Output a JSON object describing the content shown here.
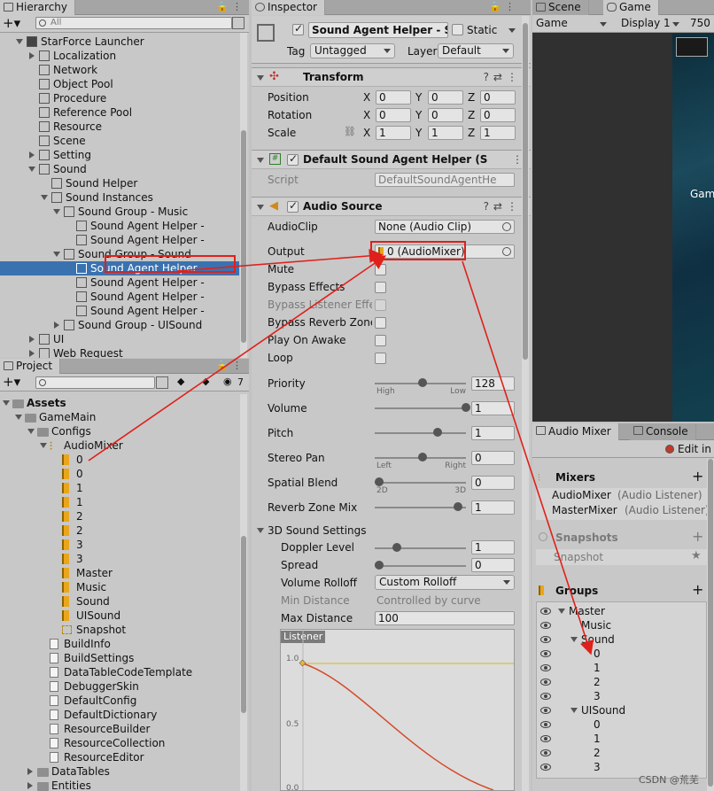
{
  "hierarchy": {
    "tab": "Hierarchy",
    "search_placeholder": "All",
    "items": [
      {
        "label": "StarForce Launcher",
        "indent": 0,
        "type": "root",
        "expanded": true
      },
      {
        "label": "Localization",
        "indent": 1,
        "type": "collapsed"
      },
      {
        "label": "Network",
        "indent": 1,
        "type": "leaf"
      },
      {
        "label": "Object Pool",
        "indent": 1,
        "type": "leaf"
      },
      {
        "label": "Procedure",
        "indent": 1,
        "type": "leaf"
      },
      {
        "label": "Reference Pool",
        "indent": 1,
        "type": "leaf"
      },
      {
        "label": "Resource",
        "indent": 1,
        "type": "leaf"
      },
      {
        "label": "Scene",
        "indent": 1,
        "type": "leaf"
      },
      {
        "label": "Setting",
        "indent": 1,
        "type": "collapsed"
      },
      {
        "label": "Sound",
        "indent": 1,
        "type": "expanded"
      },
      {
        "label": "Sound Helper",
        "indent": 2,
        "type": "leaf"
      },
      {
        "label": "Sound Instances",
        "indent": 2,
        "type": "expanded"
      },
      {
        "label": "Sound Group - Music",
        "indent": 3,
        "type": "expanded"
      },
      {
        "label": "Sound Agent Helper -",
        "indent": 4,
        "type": "leaf"
      },
      {
        "label": "Sound Agent Helper -",
        "indent": 4,
        "type": "leaf"
      },
      {
        "label": "Sound Group - Sound",
        "indent": 3,
        "type": "expanded"
      },
      {
        "label": "Sound Agent Helper -",
        "indent": 4,
        "type": "leaf",
        "selected": true
      },
      {
        "label": "Sound Agent Helper -",
        "indent": 4,
        "type": "leaf"
      },
      {
        "label": "Sound Agent Helper -",
        "indent": 4,
        "type": "leaf"
      },
      {
        "label": "Sound Agent Helper -",
        "indent": 4,
        "type": "leaf"
      },
      {
        "label": "Sound Group - UISound",
        "indent": 3,
        "type": "collapsed"
      },
      {
        "label": "UI",
        "indent": 1,
        "type": "collapsed"
      },
      {
        "label": "Web Request",
        "indent": 1,
        "type": "collapsed"
      }
    ]
  },
  "project": {
    "tab": "Project",
    "badge": "7",
    "items": [
      {
        "label": "Assets",
        "indent": 0,
        "kind": "folder",
        "expanded": true,
        "bold": true
      },
      {
        "label": "GameMain",
        "indent": 1,
        "kind": "folder",
        "expanded": true
      },
      {
        "label": "Configs",
        "indent": 2,
        "kind": "folder",
        "expanded": true
      },
      {
        "label": "AudioMixer",
        "indent": 3,
        "kind": "mixer",
        "expanded": true
      },
      {
        "label": "0",
        "indent": 4,
        "kind": "group"
      },
      {
        "label": "0",
        "indent": 4,
        "kind": "group"
      },
      {
        "label": "1",
        "indent": 4,
        "kind": "group"
      },
      {
        "label": "1",
        "indent": 4,
        "kind": "group"
      },
      {
        "label": "2",
        "indent": 4,
        "kind": "group"
      },
      {
        "label": "2",
        "indent": 4,
        "kind": "group"
      },
      {
        "label": "3",
        "indent": 4,
        "kind": "group"
      },
      {
        "label": "3",
        "indent": 4,
        "kind": "group"
      },
      {
        "label": "Master",
        "indent": 4,
        "kind": "group"
      },
      {
        "label": "Music",
        "indent": 4,
        "kind": "group"
      },
      {
        "label": "Sound",
        "indent": 4,
        "kind": "group"
      },
      {
        "label": "UISound",
        "indent": 4,
        "kind": "group"
      },
      {
        "label": "Snapshot",
        "indent": 4,
        "kind": "snapshot"
      },
      {
        "label": "BuildInfo",
        "indent": 3,
        "kind": "file"
      },
      {
        "label": "BuildSettings",
        "indent": 3,
        "kind": "file"
      },
      {
        "label": "DataTableCodeTemplate",
        "indent": 3,
        "kind": "file"
      },
      {
        "label": "DebuggerSkin",
        "indent": 3,
        "kind": "file"
      },
      {
        "label": "DefaultConfig",
        "indent": 3,
        "kind": "file"
      },
      {
        "label": "DefaultDictionary",
        "indent": 3,
        "kind": "file"
      },
      {
        "label": "ResourceBuilder",
        "indent": 3,
        "kind": "file"
      },
      {
        "label": "ResourceCollection",
        "indent": 3,
        "kind": "file"
      },
      {
        "label": "ResourceEditor",
        "indent": 3,
        "kind": "file"
      },
      {
        "label": "DataTables",
        "indent": 2,
        "kind": "folder",
        "expanded": false
      },
      {
        "label": "Entities",
        "indent": 2,
        "kind": "folder",
        "expanded": false
      }
    ]
  },
  "inspector": {
    "tab": "Inspector",
    "object_name": "Sound Agent Helper - Sou",
    "static_label": "Static",
    "tag_label": "Tag",
    "tag_value": "Untagged",
    "layer_label": "Layer",
    "layer_value": "Default",
    "transform": {
      "title": "Transform",
      "rows": [
        {
          "label": "Position",
          "x": "0",
          "y": "0",
          "z": "0"
        },
        {
          "label": "Rotation",
          "x": "0",
          "y": "0",
          "z": "0"
        },
        {
          "label": "Scale",
          "x": "1",
          "y": "1",
          "z": "1"
        }
      ]
    },
    "script_component": {
      "title": "Default Sound Agent Helper (S",
      "script_label": "Script",
      "script_value": "DefaultSoundAgentHe"
    },
    "audio_source": {
      "title": "Audio Source",
      "audioclip_label": "AudioClip",
      "audioclip_value": "None (Audio Clip)",
      "output_label": "Output",
      "output_value": "0 (AudioMixer)",
      "toggles": [
        {
          "label": "Mute",
          "disabled": false
        },
        {
          "label": "Bypass Effects",
          "disabled": false
        },
        {
          "label": "Bypass Listener Effec",
          "disabled": true
        },
        {
          "label": "Bypass Reverb Zones",
          "disabled": false
        },
        {
          "label": "Play On Awake",
          "disabled": false
        },
        {
          "label": "Loop",
          "disabled": false
        }
      ],
      "sliders": [
        {
          "label": "Priority",
          "value": "128",
          "fraction": 0.5,
          "left": "High",
          "right": "Low"
        },
        {
          "label": "Volume",
          "value": "1",
          "fraction": 1.0,
          "left": "",
          "right": ""
        },
        {
          "label": "Pitch",
          "value": "1",
          "fraction": 0.67,
          "left": "",
          "right": ""
        },
        {
          "label": "Stereo Pan",
          "value": "0",
          "fraction": 0.5,
          "left": "Left",
          "right": "Right"
        },
        {
          "label": "Spatial Blend",
          "value": "0",
          "fraction": 0.0,
          "left": "2D",
          "right": "3D"
        },
        {
          "label": "Reverb Zone Mix",
          "value": "1",
          "fraction": 0.91,
          "left": "",
          "right": ""
        }
      ],
      "sound3d": {
        "title": "3D Sound Settings",
        "doppler_label": "Doppler Level",
        "doppler_value": "1",
        "doppler_fraction": 0.2,
        "spread_label": "Spread",
        "spread_value": "0",
        "spread_fraction": 0.0,
        "rolloff_label": "Volume Rolloff",
        "rolloff_value": "Custom Rolloff",
        "mindist_label": "Min Distance",
        "mindist_value": "Controlled by curve",
        "maxdist_label": "Max Distance",
        "maxdist_value": "100",
        "graph_tag": "Listener",
        "graph_ticks": [
          "1.0",
          "0.5",
          "0.0"
        ]
      }
    }
  },
  "game": {
    "tab_scene": "Scene",
    "tab_game": "Game",
    "display_mode": "Game",
    "display": "Display 1",
    "resolution": "750",
    "overlay_text": "Gam"
  },
  "audio_mixer": {
    "tab": "Audio Mixer",
    "tab_console": "Console",
    "edit_label": "Edit in P",
    "mixers_title": "Mixers",
    "mixers": [
      {
        "name": "AudioMixer",
        "note": "(Audio Listener)"
      },
      {
        "name": "MasterMixer",
        "note": "(Audio Listener)"
      }
    ],
    "snapshots_title": "Snapshots",
    "snapshot_item": "Snapshot",
    "groups_title": "Groups",
    "groups": [
      {
        "label": "Master",
        "indent": 0,
        "expanded": true
      },
      {
        "label": "Music",
        "indent": 1,
        "expanded": null
      },
      {
        "label": "Sound",
        "indent": 1,
        "expanded": true
      },
      {
        "label": "0",
        "indent": 2,
        "expanded": null
      },
      {
        "label": "1",
        "indent": 2,
        "expanded": null
      },
      {
        "label": "2",
        "indent": 2,
        "expanded": null
      },
      {
        "label": "3",
        "indent": 2,
        "expanded": null
      },
      {
        "label": "UISound",
        "indent": 1,
        "expanded": true
      },
      {
        "label": "0",
        "indent": 2,
        "expanded": null
      },
      {
        "label": "1",
        "indent": 2,
        "expanded": null
      },
      {
        "label": "2",
        "indent": 2,
        "expanded": null
      },
      {
        "label": "3",
        "indent": 2,
        "expanded": null
      }
    ]
  },
  "watermark": "CSDN @荒芜",
  "colors": {
    "selection": "#3a72b0",
    "annotation": "#e0201a",
    "mixer_icon": "#e9a61c"
  }
}
